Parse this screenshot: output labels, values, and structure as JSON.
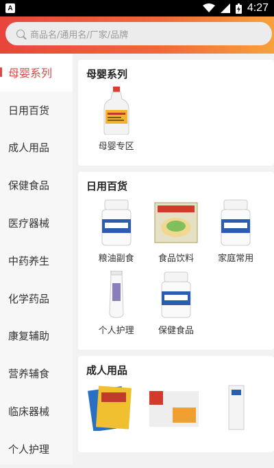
{
  "status_bar": {
    "time": "4:27"
  },
  "search": {
    "placeholder": "商品名/通用名/厂家/品牌"
  },
  "sidebar": {
    "items": [
      {
        "label": "母婴系列",
        "active": true
      },
      {
        "label": "日用百货"
      },
      {
        "label": "成人用品"
      },
      {
        "label": "保健食品"
      },
      {
        "label": "医疗器械"
      },
      {
        "label": "中药养生"
      },
      {
        "label": "化学药品"
      },
      {
        "label": "康复辅助"
      },
      {
        "label": "营养辅食"
      },
      {
        "label": "临床器械"
      },
      {
        "label": "个人护理"
      }
    ]
  },
  "sections": [
    {
      "title": "母婴系列",
      "items": [
        {
          "label": "母婴专区",
          "icon": "bottle-image"
        }
      ]
    },
    {
      "title": "日用百货",
      "items": [
        {
          "label": "粮油副食",
          "icon": "pill-bottle-image"
        },
        {
          "label": "食品饮料",
          "icon": "food-package-image"
        },
        {
          "label": "家庭常用",
          "icon": "pill-bottle-image"
        },
        {
          "label": "个人护理",
          "icon": "tube-image"
        },
        {
          "label": "保健食品",
          "icon": "pill-bottle-image"
        }
      ]
    },
    {
      "title": "成人用品",
      "items": []
    }
  ]
}
